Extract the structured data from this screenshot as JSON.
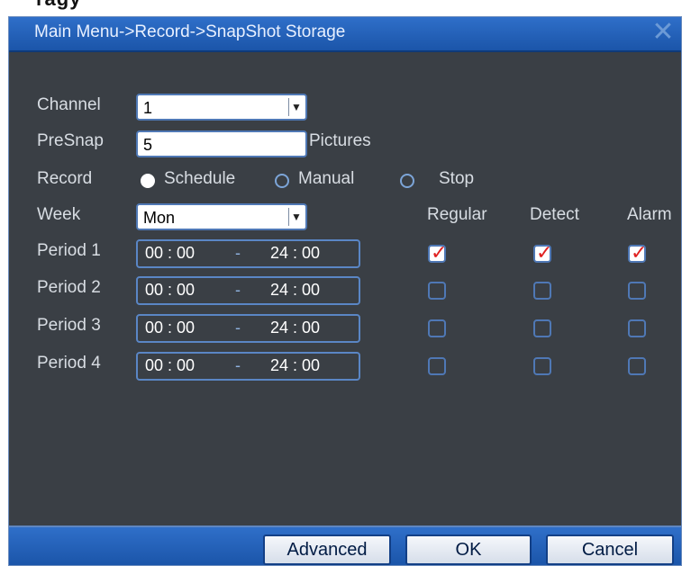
{
  "window": {
    "title": "Main Menu->Record->SnapShot Storage"
  },
  "labels": {
    "channel": "Channel",
    "presnap": "PreSnap",
    "pictures": "Pictures",
    "record": "Record",
    "week": "Week",
    "regular": "Regular",
    "detect": "Detect",
    "alarm": "Alarm"
  },
  "fields": {
    "channel_value": "1",
    "presnap_value": "5",
    "week_value": "Mon"
  },
  "record_options": [
    {
      "label": "Schedule",
      "selected": true
    },
    {
      "label": "Manual",
      "selected": false
    },
    {
      "label": "Stop",
      "selected": false
    }
  ],
  "periods": [
    {
      "label": "Period 1",
      "start": "00 : 00",
      "end": "24 : 00",
      "regular": true,
      "detect": true,
      "alarm": true
    },
    {
      "label": "Period 2",
      "start": "00 : 00",
      "end": "24 : 00",
      "regular": false,
      "detect": false,
      "alarm": false
    },
    {
      "label": "Period 3",
      "start": "00 : 00",
      "end": "24 : 00",
      "regular": false,
      "detect": false,
      "alarm": false
    },
    {
      "label": "Period 4",
      "start": "00 : 00",
      "end": "24 : 00",
      "regular": false,
      "detect": false,
      "alarm": false
    }
  ],
  "separator": "-",
  "buttons": {
    "advanced": "Advanced",
    "ok": "OK",
    "cancel": "Cancel"
  }
}
